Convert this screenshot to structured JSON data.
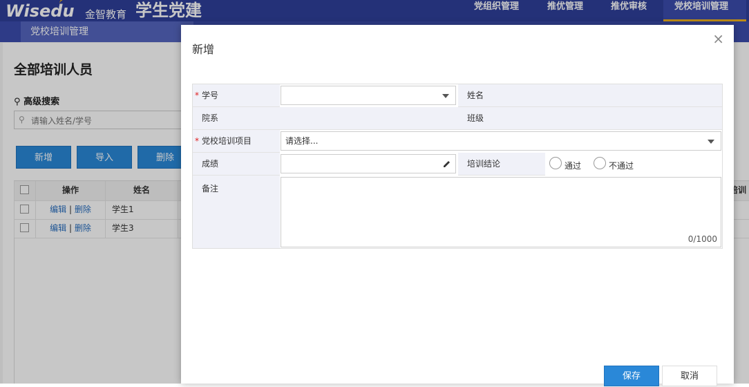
{
  "header": {
    "logo": "Wisedu",
    "logo_cn": "金智教育",
    "system_title": "学生党建",
    "nav": [
      "党组织管理",
      "推优管理",
      "推优审核",
      "党校培训管理"
    ]
  },
  "subnav": {
    "active_tab": "党校培训管理"
  },
  "page": {
    "title": "全部培训人员",
    "advanced_search": "高级搜索",
    "search_placeholder": "请输入姓名/学号",
    "buttons": [
      "新增",
      "导入",
      "删除"
    ],
    "table": {
      "headers": [
        "操作",
        "姓名"
      ],
      "partial_header": "培训",
      "rows": [
        {
          "edit": "编辑",
          "sep": "|",
          "del": "删除",
          "name": "学生1"
        },
        {
          "edit": "编辑",
          "sep": "|",
          "del": "删除",
          "name": "学生3"
        }
      ]
    }
  },
  "modal": {
    "title": "新增",
    "close": "×",
    "fields": {
      "student_id": {
        "label": "学号",
        "value": ""
      },
      "name": {
        "label": "姓名",
        "value": ""
      },
      "department": {
        "label": "院系",
        "value": ""
      },
      "class": {
        "label": "班级",
        "value": ""
      },
      "project": {
        "label": "党校培训项目",
        "placeholder": "请选择..."
      },
      "score": {
        "label": "成绩",
        "value": ""
      },
      "conclusion": {
        "label": "培训结论",
        "options": [
          "通过",
          "不通过"
        ]
      },
      "remark": {
        "label": "备注",
        "counter": "0/1000"
      }
    },
    "required_mark": "*",
    "save_label": "保存",
    "cancel_label": "取消"
  },
  "colors": {
    "header_bg": "#2f3f9a",
    "accent": "#2a88d8",
    "active_underline": "#f2b21c"
  },
  "icons": [
    "search-icon",
    "pencil-icon",
    "close-icon",
    "dropdown-arrow-icon"
  ]
}
